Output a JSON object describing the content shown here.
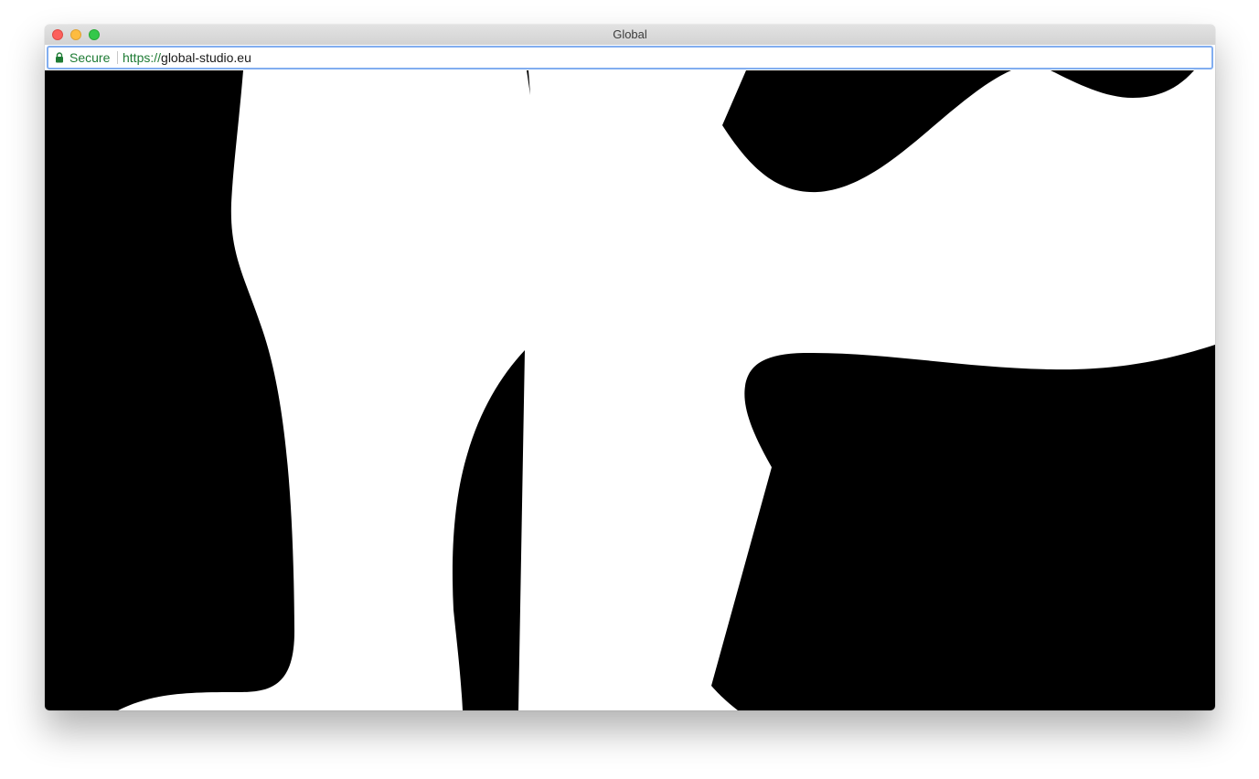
{
  "window": {
    "title": "Global"
  },
  "address_bar": {
    "security_label": "Secure",
    "url_scheme": "https://",
    "url_host": "global-studio.eu"
  },
  "page": {
    "background_color": "#000000",
    "shape_color": "#ffffff"
  },
  "colors": {
    "secure_green": "#1e7b34",
    "focus_ring": "#82aef0",
    "close": "#fc605c",
    "minimize": "#fdbc40",
    "maximize": "#34c84a"
  }
}
